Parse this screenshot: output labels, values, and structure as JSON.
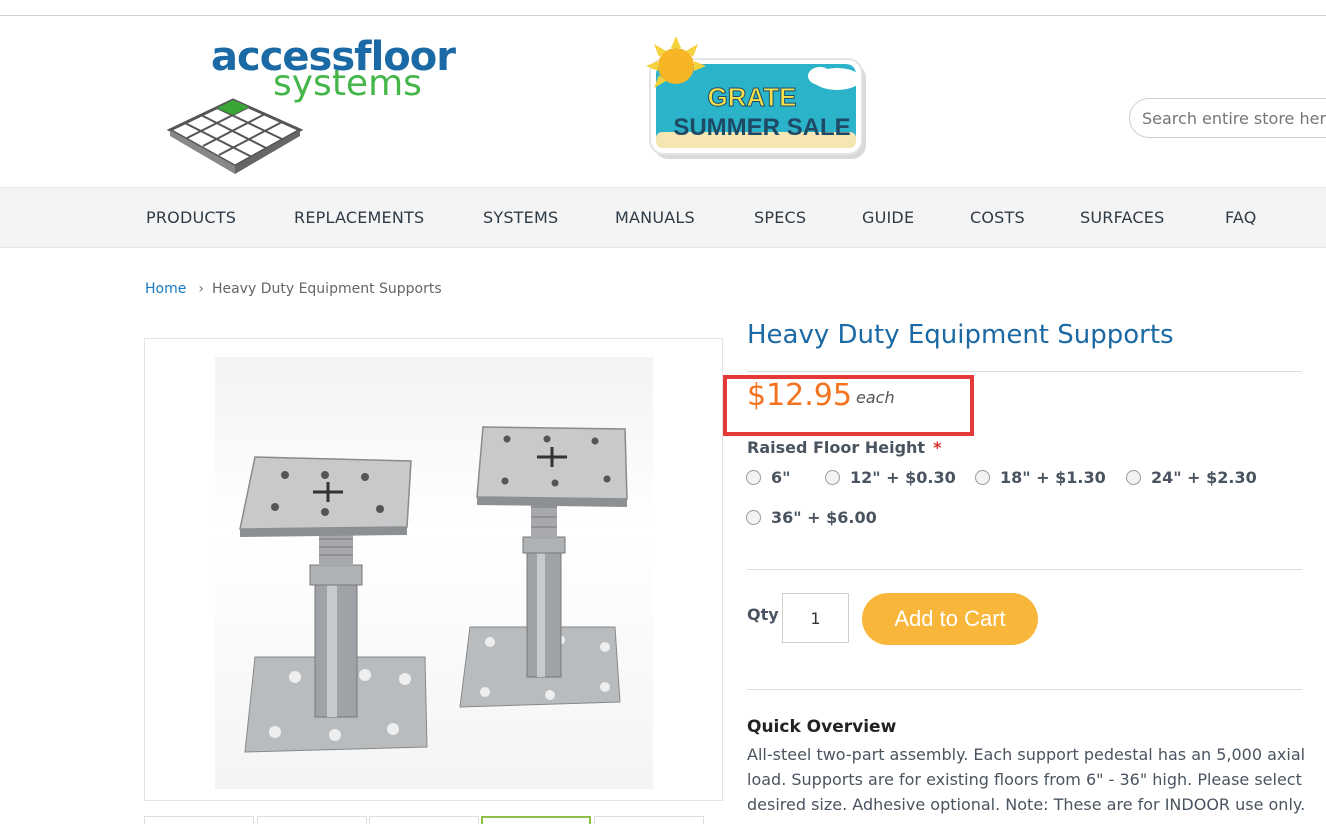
{
  "header": {
    "logo": {
      "line1": "accessfloor",
      "line2": "systems"
    },
    "promo": {
      "line1": "GRATE",
      "line2": "SUMMER SALE"
    },
    "search": {
      "placeholder": "Search entire store here..."
    }
  },
  "nav": {
    "items": [
      "PRODUCTS",
      "REPLACEMENTS",
      "SYSTEMS",
      "MANUALS",
      "SPECS",
      "GUIDE",
      "COSTS",
      "SURFACES",
      "FAQ"
    ]
  },
  "breadcrumb": {
    "home": "Home",
    "current": "Heavy Duty Equipment Supports"
  },
  "product": {
    "title": "Heavy Duty Equipment Supports",
    "price": "$12.95",
    "price_unit": "each",
    "option": {
      "label": "Raised Floor Height",
      "required_mark": "*",
      "choices": [
        "6\"",
        "12\" + $0.30",
        "18\" + $1.30",
        "24\" + $2.30",
        "36\" + $6.00"
      ]
    },
    "qty_label": "Qty",
    "qty_value": "1",
    "add_to_cart": "Add to Cart",
    "overview_title": "Quick Overview",
    "overview_text": "All-steel two-part assembly. Each support pedestal has an 5,000 axial load. Supports are for existing floors from 6\" - 36\" high. Please select desired size. Adhesive optional. Note:  These are for INDOOR use only."
  },
  "colors": {
    "brand_blue": "#1b6aa5",
    "price_orange": "#f4731f",
    "cart_button": "#f8b73b",
    "highlight_box": "#e53939"
  }
}
